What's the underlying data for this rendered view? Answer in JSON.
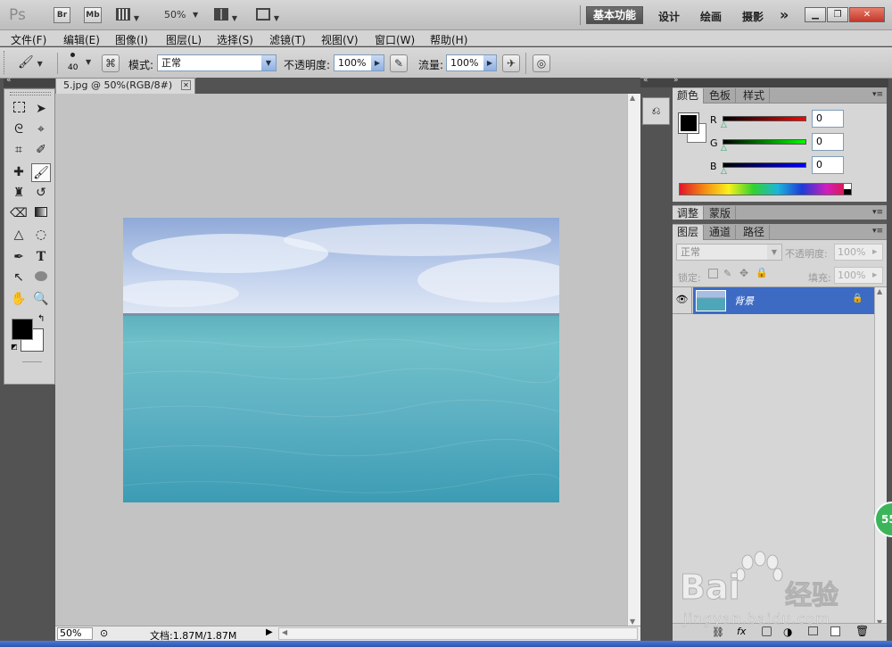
{
  "app": {
    "logo": "Ps",
    "bridge_btn": "Br",
    "minibridge_btn": "Mb",
    "zoom": "50%",
    "workspaces": [
      "基本功能",
      "设计",
      "绘画",
      "摄影"
    ],
    "more": "»"
  },
  "menu": [
    "文件(F)",
    "编辑(E)",
    "图像(I)",
    "图层(L)",
    "选择(S)",
    "滤镜(T)",
    "视图(V)",
    "窗口(W)",
    "帮助(H)"
  ],
  "options": {
    "brush_size": "40",
    "mode_label": "模式:",
    "mode_value": "正常",
    "opacity_label": "不透明度:",
    "opacity_value": "100%",
    "flow_label": "流量:",
    "flow_value": "100%"
  },
  "document": {
    "tab_title": "5.jpg @ 50%(RGB/8#)",
    "status_zoom": "50%",
    "status_doc": "文档:1.87M/1.87M"
  },
  "color_panel": {
    "tabs": [
      "颜色",
      "色板",
      "样式"
    ],
    "r_label": "R",
    "g_label": "G",
    "b_label": "B",
    "r_value": "0",
    "g_value": "0",
    "b_value": "0"
  },
  "adjust_panel": {
    "tabs": [
      "调整",
      "蒙版"
    ]
  },
  "layers_panel": {
    "tabs": [
      "图层",
      "通道",
      "路径"
    ],
    "blend_mode": "正常",
    "opacity_label": "不透明度:",
    "opacity_value": "100%",
    "lock_label": "锁定:",
    "fill_label": "填充:",
    "fill_value": "100%",
    "layers": [
      {
        "name": "背景",
        "visible": true,
        "locked": true
      }
    ]
  },
  "watermark": {
    "brand": "Bai",
    "brand2": "经验",
    "url": "jingyan.baidu.com",
    "badge": "55"
  },
  "colors": {
    "accent_active_layer": "#3d6bc4",
    "foreground": "#000000",
    "background": "#ffffff"
  }
}
